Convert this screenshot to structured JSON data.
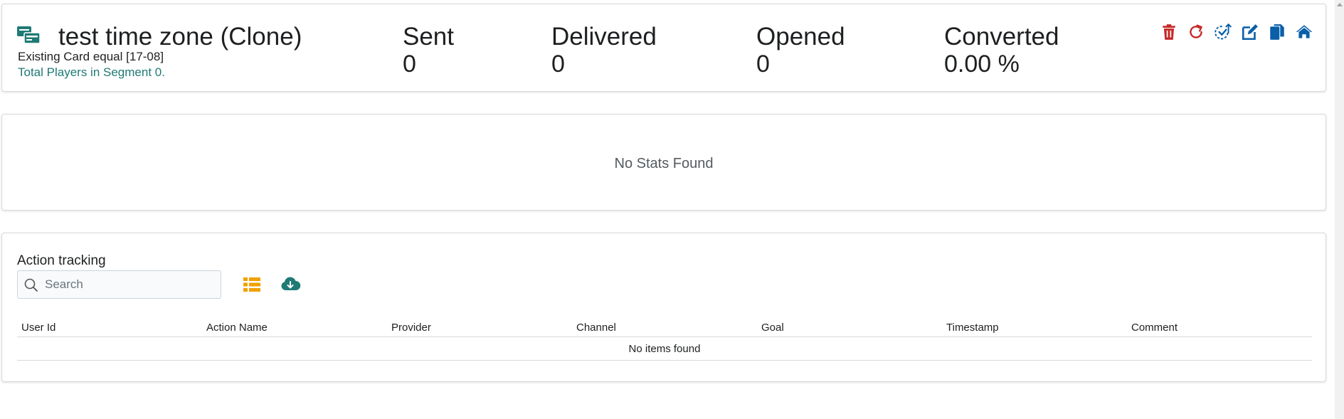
{
  "campaign": {
    "title": "test time zone (Clone)",
    "segment_description": "Existing Card equal [17-08]",
    "segment_players_link": "Total Players in Segment 0."
  },
  "stats": [
    {
      "label": "Sent",
      "value": "0"
    },
    {
      "label": "Delivered",
      "value": "0"
    },
    {
      "label": "Opened",
      "value": "0"
    },
    {
      "label": "Converted",
      "value": "0.00 %"
    }
  ],
  "toolbar": {
    "icons": [
      "trash-icon",
      "refresh-icon",
      "approve-check-icon",
      "edit-icon",
      "copy-icon",
      "home-icon"
    ],
    "colors": {
      "danger": "#c62828",
      "primary": "#0a5fa8",
      "teal": "#1f7a75",
      "amber": "#f0a000"
    }
  },
  "stats_panel": {
    "empty_message": "No Stats Found"
  },
  "action_tracking": {
    "title": "Action tracking",
    "search_placeholder": "Search",
    "columns": [
      "User Id",
      "Action Name",
      "Provider",
      "Channel",
      "Goal",
      "Timestamp",
      "Comment"
    ],
    "empty_message": "No items found",
    "tool_icons": [
      "list-view-icon",
      "cloud-download-icon"
    ]
  }
}
